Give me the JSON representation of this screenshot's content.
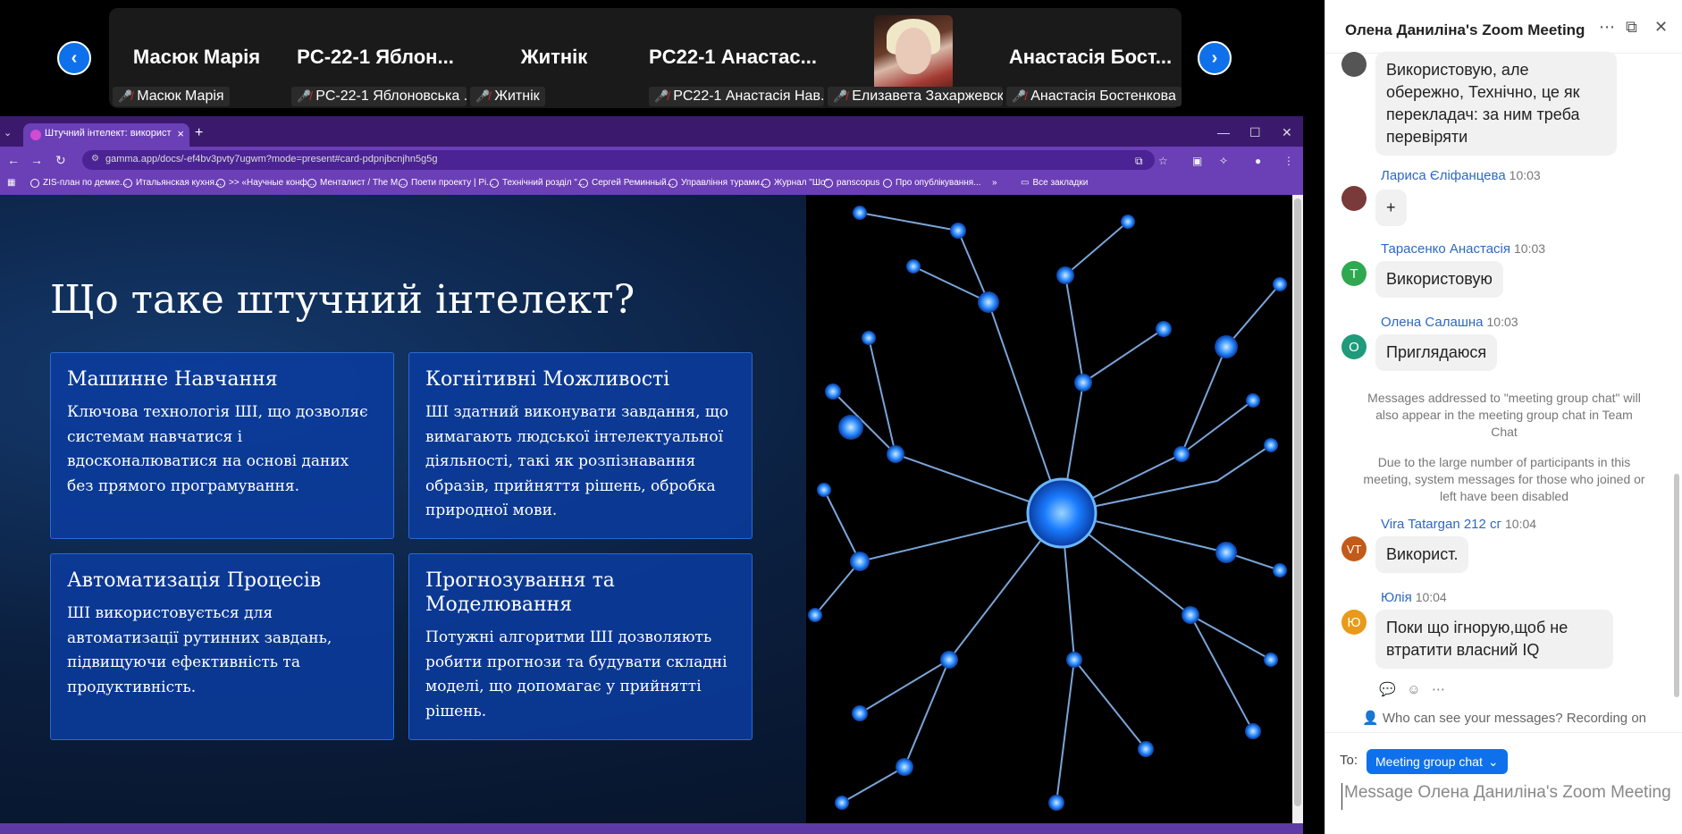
{
  "participants": {
    "tiles": [
      {
        "big": "Масюк Марія",
        "small": "Масюк Марія"
      },
      {
        "big": "PC-22-1 Яблон...",
        "small": "PC-22-1 Яблоновська ..."
      },
      {
        "big": "Житнік",
        "small": "Житнік"
      },
      {
        "big": "PC22-1  Анастас...",
        "small": "PC22-1 Анастасія Нав..."
      },
      {
        "big": "",
        "small": "Елизавета Захаржевск..."
      },
      {
        "big": "Анастасія Бост...",
        "small": "Анастасія Бостенкова"
      }
    ]
  },
  "browser": {
    "tab_title": "Штучний інтелект: використ",
    "url": "gamma.app/docs/-ef4bv3pvty7ugwm?mode=present#card-pdpnjbcnjhn5g5g",
    "bookmarks": [
      "ZIS-план по демке...",
      "Итальянская кухня...",
      ">> «Научные конф...",
      "Менталист / The M...",
      "Поети проекту | Рі...",
      "Технічний розділ \"...",
      "Сергей Реминный...",
      "Управління турами...",
      "Журнал \"Шо\"",
      "panscopus",
      "Про опублікування..."
    ],
    "all_bookmarks": "Все закладки"
  },
  "slide": {
    "title": "Що таке штучний інтелект?",
    "cards": [
      {
        "title": "Машинне Навчання",
        "text": "Ключова технологія ШІ, що дозволяє системам навчатися і вдосконалюватися на основі даних без прямого програмування."
      },
      {
        "title": "Когнітивні Можливості",
        "text": "ШІ здатний виконувати завдання, що вимагають людської інтелектуальної діяльності, такі як розпізнавання образів, прийняття рішень, обробка природної мови."
      },
      {
        "title": "Автоматизація Процесів",
        "text": "ШІ використовується для автоматизації рутинних завдань, підвищуючи ефективність та продуктивність."
      },
      {
        "title": "Прогнозування та Моделювання",
        "text": "Потужні алгоритми ШІ дозволяють робити прогнози та будувати складні моделі, що допомагає у прийнятті рішень."
      }
    ]
  },
  "chat": {
    "title": "Олена Даниліна's Zoom Meeting",
    "first_message": "Використовую, але обережно, Технічно, це як перекладач: за ним треба перевіряти",
    "messages": [
      {
        "sender": "Лариса Єліфанцева",
        "time": "10:03",
        "text": "+",
        "avatar": "",
        "color": "#a33"
      },
      {
        "sender": "Тарасенко Анастасія",
        "time": "10:03",
        "text": "Використовую",
        "avatar": "T",
        "color": "#2fa84f"
      },
      {
        "sender": "Олена Салашна",
        "time": "10:03",
        "text": "Приглядаюся",
        "avatar": "O",
        "color": "#1f9a7a"
      },
      {
        "sender": "Vira Tatargan 212 сг",
        "time": "10:04",
        "text": "Використ.",
        "avatar": "VT",
        "color": "#c25a1a"
      },
      {
        "sender": "Юлія",
        "time": "10:04",
        "text": "Поки що ігнорую,щоб не втратити власний IQ",
        "avatar": "Ю",
        "color": "#e89a1a"
      }
    ],
    "system_note_1": "Messages addressed to \"meeting group chat\" will also appear in the meeting group chat in Team Chat",
    "system_note_2": "Due to the large number of participants in this meeting, system messages for those who joined or left have been disabled",
    "privacy": "Who can see your messages? Recording on",
    "to_label": "To:",
    "to_value": "Meeting group chat",
    "compose_placeholder": "Message Олена Даниліна's Zoom Meeting"
  }
}
